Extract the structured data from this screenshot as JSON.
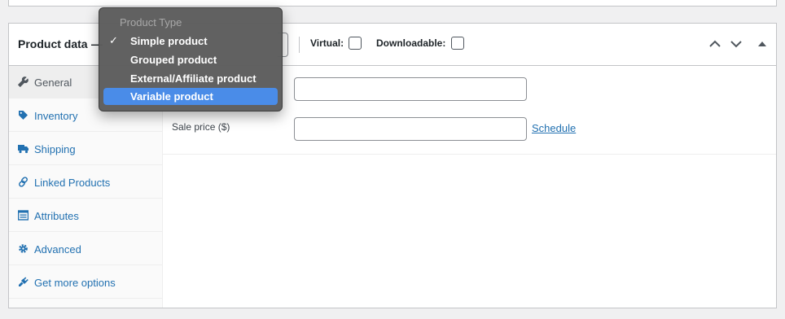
{
  "header": {
    "title": "Product data —",
    "virtual_label": "Virtual:",
    "downloadable_label": "Downloadable:"
  },
  "dropdown": {
    "group_label": "Product Type",
    "items": [
      {
        "label": "Simple product",
        "checked": true
      },
      {
        "label": "Grouped product",
        "checked": false
      },
      {
        "label": "External/Affiliate product",
        "checked": false
      },
      {
        "label": "Variable product",
        "checked": false,
        "highlighted": true
      }
    ],
    "check_mark": "✓"
  },
  "tabs": [
    {
      "label": "General",
      "icon": "wrench-icon",
      "active": true
    },
    {
      "label": "Inventory",
      "icon": "tag-icon"
    },
    {
      "label": "Shipping",
      "icon": "truck-icon"
    },
    {
      "label": "Linked Products",
      "icon": "link-icon"
    },
    {
      "label": "Attributes",
      "icon": "list-icon"
    },
    {
      "label": "Advanced",
      "icon": "gear-icon"
    },
    {
      "label": "Get more options",
      "icon": "plugin-icon"
    }
  ],
  "general": {
    "regular_price_value": "",
    "sale_price_label": "Sale price ($)",
    "sale_price_value": "",
    "schedule_link": "Schedule"
  },
  "colors": {
    "link": "#2271b1",
    "highlight": "#4a8ce8",
    "menu_bg": "#5c5c5c"
  }
}
